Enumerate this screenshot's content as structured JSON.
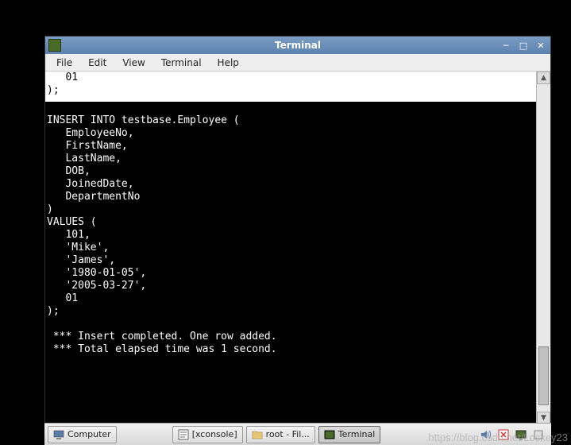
{
  "window": {
    "title": "Terminal"
  },
  "menubar": {
    "file": "File",
    "edit": "Edit",
    "view": "View",
    "terminal": "Terminal",
    "help": "Help"
  },
  "terminal": {
    "top_fragment": "   01\n);",
    "content": "\n\nINSERT INTO testbase.Employee (\n   EmployeeNo,\n   FirstName,\n   LastName,\n   DOB,\n   JoinedDate,\n   DepartmentNo\n)\nVALUES (\n   101,\n   'Mike',\n   'James',\n   '1980-01-05',\n   '2005-03-27',\n   01\n);\n\n *** Insert completed. One row added.\n *** Total elapsed time was 1 second.\n"
  },
  "taskbar": {
    "computer": "Computer",
    "xconsole": "[xconsole]",
    "root_fil": "root - Fil...",
    "terminal": "Terminal"
  },
  "watermark": "https://blog.csdn.net/Lockey23"
}
